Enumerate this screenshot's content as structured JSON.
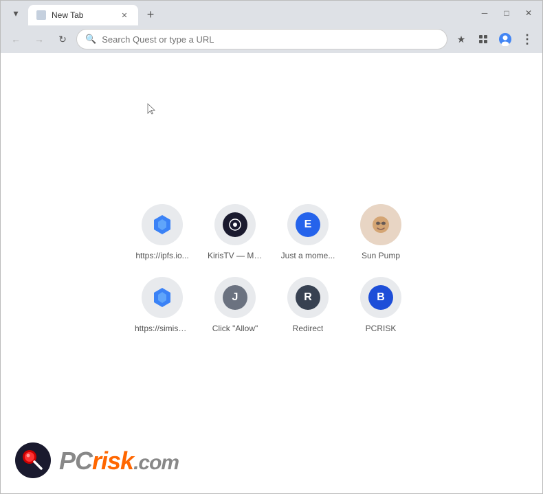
{
  "window": {
    "title": "New Tab"
  },
  "tab": {
    "label": "New Tab",
    "favicon_color": "#4285f4"
  },
  "toolbar": {
    "search_placeholder": "Search Quest or type a URL",
    "back_label": "←",
    "forward_label": "→",
    "refresh_label": "↻",
    "star_label": "☆",
    "extensions_label": "⊞",
    "profile_label": "👤",
    "menu_label": "⋮",
    "minimize_label": "─",
    "maximize_label": "□",
    "close_label": "✕",
    "dropdown_label": "▾",
    "newtab_label": "+"
  },
  "speed_dial": {
    "items": [
      {
        "id": "ipfs",
        "label": "https://ipfs.io...",
        "icon_letter": "🔷",
        "icon_type": "blue-hex",
        "bg_color": "#e8eaed"
      },
      {
        "id": "kiristv",
        "label": "KirisTV — Mo...",
        "icon_letter": "⏺",
        "icon_type": "dark-circle",
        "bg_color": "#e8eaed"
      },
      {
        "id": "justamome",
        "label": "Just a mome...",
        "icon_letter": "E",
        "icon_type": "blue-letter",
        "bg_color": "#e8eaed"
      },
      {
        "id": "sunpump",
        "label": "Sun Pump",
        "icon_letter": "🌞",
        "icon_type": "skin-emoji",
        "bg_color": "#e8eaed"
      },
      {
        "id": "simise",
        "label": "https://simise...",
        "icon_letter": "🔷",
        "icon_type": "blue-hex2",
        "bg_color": "#e8eaed"
      },
      {
        "id": "clickallow",
        "label": "Click \"Allow\"",
        "icon_letter": "J",
        "icon_type": "gray-letter",
        "bg_color": "#e8eaed"
      },
      {
        "id": "redirect",
        "label": "Redirect",
        "icon_letter": "R",
        "icon_type": "darkgray-letter",
        "bg_color": "#e8eaed"
      },
      {
        "id": "pcrisk",
        "label": "PCRISK",
        "icon_letter": "B",
        "icon_type": "blue4-letter",
        "bg_color": "#e8eaed"
      }
    ]
  },
  "watermark": {
    "pc_text": "PC",
    "risk_text": "risk",
    "com_text": ".com"
  }
}
